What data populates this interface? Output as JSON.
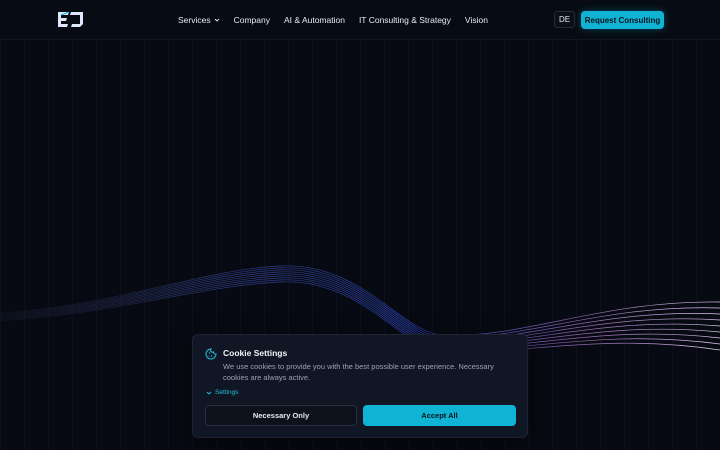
{
  "header": {
    "nav": [
      {
        "label": "Services",
        "has_dropdown": true
      },
      {
        "label": "Company"
      },
      {
        "label": "AI & Automation"
      },
      {
        "label": "IT Consulting & Strategy"
      },
      {
        "label": "Vision"
      }
    ],
    "language": "DE",
    "cta_label": "Request Consulting"
  },
  "cookie": {
    "title": "Cookie Settings",
    "text": "We use cookies to provide you with the best possible user experience. Necessary cookies are always active.",
    "settings_label": "Settings",
    "necessary_label": "Necessary Only",
    "accept_label": "Accept All"
  },
  "colors": {
    "background": "#070a12",
    "accent": "#10b3d4",
    "wave_left": "#3b4a8a",
    "wave_right": "#b58ac9"
  },
  "icons": [
    "logo",
    "chevron-down-icon",
    "cookie-icon"
  ]
}
